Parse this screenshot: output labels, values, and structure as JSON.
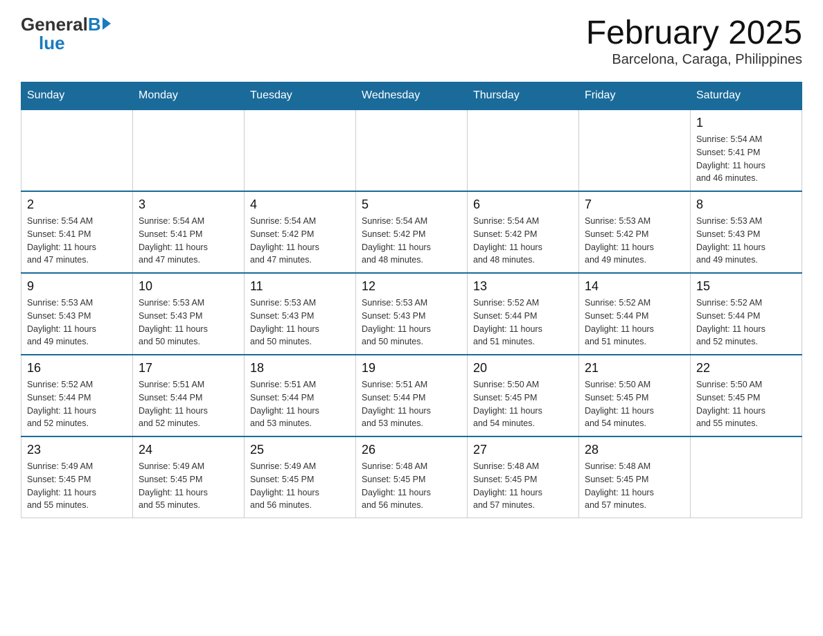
{
  "logo": {
    "general": "General",
    "blue": "Blue",
    "arrow": "▶"
  },
  "title": "February 2025",
  "subtitle": "Barcelona, Caraga, Philippines",
  "days": [
    "Sunday",
    "Monday",
    "Tuesday",
    "Wednesday",
    "Thursday",
    "Friday",
    "Saturday"
  ],
  "weeks": [
    [
      {
        "day": "",
        "info": ""
      },
      {
        "day": "",
        "info": ""
      },
      {
        "day": "",
        "info": ""
      },
      {
        "day": "",
        "info": ""
      },
      {
        "day": "",
        "info": ""
      },
      {
        "day": "",
        "info": ""
      },
      {
        "day": "1",
        "info": "Sunrise: 5:54 AM\nSunset: 5:41 PM\nDaylight: 11 hours\nand 46 minutes."
      }
    ],
    [
      {
        "day": "2",
        "info": "Sunrise: 5:54 AM\nSunset: 5:41 PM\nDaylight: 11 hours\nand 47 minutes."
      },
      {
        "day": "3",
        "info": "Sunrise: 5:54 AM\nSunset: 5:41 PM\nDaylight: 11 hours\nand 47 minutes."
      },
      {
        "day": "4",
        "info": "Sunrise: 5:54 AM\nSunset: 5:42 PM\nDaylight: 11 hours\nand 47 minutes."
      },
      {
        "day": "5",
        "info": "Sunrise: 5:54 AM\nSunset: 5:42 PM\nDaylight: 11 hours\nand 48 minutes."
      },
      {
        "day": "6",
        "info": "Sunrise: 5:54 AM\nSunset: 5:42 PM\nDaylight: 11 hours\nand 48 minutes."
      },
      {
        "day": "7",
        "info": "Sunrise: 5:53 AM\nSunset: 5:42 PM\nDaylight: 11 hours\nand 49 minutes."
      },
      {
        "day": "8",
        "info": "Sunrise: 5:53 AM\nSunset: 5:43 PM\nDaylight: 11 hours\nand 49 minutes."
      }
    ],
    [
      {
        "day": "9",
        "info": "Sunrise: 5:53 AM\nSunset: 5:43 PM\nDaylight: 11 hours\nand 49 minutes."
      },
      {
        "day": "10",
        "info": "Sunrise: 5:53 AM\nSunset: 5:43 PM\nDaylight: 11 hours\nand 50 minutes."
      },
      {
        "day": "11",
        "info": "Sunrise: 5:53 AM\nSunset: 5:43 PM\nDaylight: 11 hours\nand 50 minutes."
      },
      {
        "day": "12",
        "info": "Sunrise: 5:53 AM\nSunset: 5:43 PM\nDaylight: 11 hours\nand 50 minutes."
      },
      {
        "day": "13",
        "info": "Sunrise: 5:52 AM\nSunset: 5:44 PM\nDaylight: 11 hours\nand 51 minutes."
      },
      {
        "day": "14",
        "info": "Sunrise: 5:52 AM\nSunset: 5:44 PM\nDaylight: 11 hours\nand 51 minutes."
      },
      {
        "day": "15",
        "info": "Sunrise: 5:52 AM\nSunset: 5:44 PM\nDaylight: 11 hours\nand 52 minutes."
      }
    ],
    [
      {
        "day": "16",
        "info": "Sunrise: 5:52 AM\nSunset: 5:44 PM\nDaylight: 11 hours\nand 52 minutes."
      },
      {
        "day": "17",
        "info": "Sunrise: 5:51 AM\nSunset: 5:44 PM\nDaylight: 11 hours\nand 52 minutes."
      },
      {
        "day": "18",
        "info": "Sunrise: 5:51 AM\nSunset: 5:44 PM\nDaylight: 11 hours\nand 53 minutes."
      },
      {
        "day": "19",
        "info": "Sunrise: 5:51 AM\nSunset: 5:44 PM\nDaylight: 11 hours\nand 53 minutes."
      },
      {
        "day": "20",
        "info": "Sunrise: 5:50 AM\nSunset: 5:45 PM\nDaylight: 11 hours\nand 54 minutes."
      },
      {
        "day": "21",
        "info": "Sunrise: 5:50 AM\nSunset: 5:45 PM\nDaylight: 11 hours\nand 54 minutes."
      },
      {
        "day": "22",
        "info": "Sunrise: 5:50 AM\nSunset: 5:45 PM\nDaylight: 11 hours\nand 55 minutes."
      }
    ],
    [
      {
        "day": "23",
        "info": "Sunrise: 5:49 AM\nSunset: 5:45 PM\nDaylight: 11 hours\nand 55 minutes."
      },
      {
        "day": "24",
        "info": "Sunrise: 5:49 AM\nSunset: 5:45 PM\nDaylight: 11 hours\nand 55 minutes."
      },
      {
        "day": "25",
        "info": "Sunrise: 5:49 AM\nSunset: 5:45 PM\nDaylight: 11 hours\nand 56 minutes."
      },
      {
        "day": "26",
        "info": "Sunrise: 5:48 AM\nSunset: 5:45 PM\nDaylight: 11 hours\nand 56 minutes."
      },
      {
        "day": "27",
        "info": "Sunrise: 5:48 AM\nSunset: 5:45 PM\nDaylight: 11 hours\nand 57 minutes."
      },
      {
        "day": "28",
        "info": "Sunrise: 5:48 AM\nSunset: 5:45 PM\nDaylight: 11 hours\nand 57 minutes."
      },
      {
        "day": "",
        "info": ""
      }
    ]
  ]
}
